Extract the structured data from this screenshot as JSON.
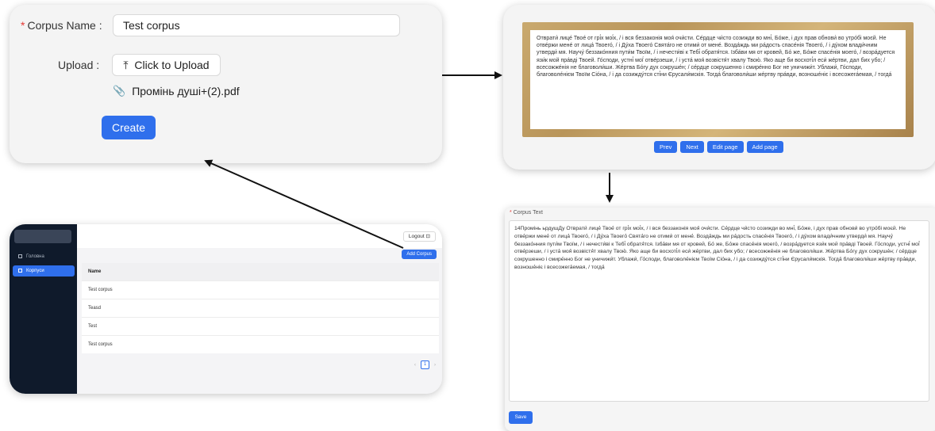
{
  "create_form": {
    "name_label": "Corpus Name",
    "name_value": "Test corpus",
    "upload_label": "Upload",
    "upload_button": "Click to Upload",
    "file_name": "Промінь душі+(2).pdf",
    "create_button": "Create"
  },
  "page_viewer": {
    "page_text": "Отврати́ лице́ Твое́ от грі́х моі́х, / і вся беззаконія моя́ очи́сти. Се́рдце чи́сто созижди во мні́, Бо́же, і дух прав обнови́ во утро́бі моєй. Не отве́ржи мене́ от лица́ Твоего́, / і Ду́ха Твоего́ Свята́го не отими́ от мене́. Возда́ждь ми ра́дость спасе́нія Твоего́, / і ду́хом влади́чним утверди́ мя. Научу́ беззако́нния пути́м Твоїм, / і нечести́ві к Тебі́ обратя́тся. Ізба́ви мя от кровей, Бо́ же, Бо́же спасе́нія моего́, / возра́дуется язи́к мой пра́вді Твоей. Го́споди, устні́ мої́ отве́рзеши, / і уста́ моя́ возвістя́т хвалу Твою́. Яко аще би восхоті́л еси́ же́ртви, дал бих убо; / всесожже́нія не благоволи́ши. Же́ртва Бо́гу дух сокруше́н; / се́рдце сокрушенно і смире́нно Бог не уничижи́т. Ублажи́, Го́споди, благоволе́нієм Твоїм Сіо́на, / і да созижду́тся сті́ни Єрусали́мскія. Тогда́ благоволи́ши же́ртву пра́вди, возноше́ніє і всесожега́емая, / тогда́",
    "buttons": [
      "Prev",
      "Next",
      "Edit page",
      "Add page"
    ]
  },
  "corpus_list": {
    "sidebar": [
      {
        "label": "Головна",
        "icon": "home-icon",
        "active": false
      },
      {
        "label": "Корпуси",
        "icon": "table-icon",
        "active": true
      }
    ],
    "logout_button": "Logout",
    "add_button": "Add Corpus",
    "column_header": "Name",
    "rows": [
      "Test corpus",
      "Teasd",
      "Test",
      "Test corpus"
    ],
    "current_page": "1"
  },
  "corpus_text": {
    "label": "Corpus Text",
    "text": "14Промінь ьрдушДу Отврати́ лице́ Твое́ от грі́х моі́х, / і вся беззаконія моя́ очи́сти. Се́рдце чи́сто созижди во мні́, Бо́же, і дух прав обнови́ во утро́бі моєй. Не отве́ржи мене́ от лица́ Твоего́, / і Ду́ха Твоего́ Свята́го не отими́ от мене́. Возда́ждь ми ра́дость спасе́нія Твоего́, / і ду́хом влади́чним утверди́ мя. Научу́ беззако́нния пути́м Твоїм, / і нечести́ві к Тебі́ обратя́тся. Ізба́ви мя от кровей, Бо́ же, Бо́же спасе́нія моего́, / возра́дуется язи́к мой пра́вді Твоей. Го́споди, устні́ мої́ отве́рзеши, / і уста́ моя́ возвістя́т хвалу Твою́. Яко аще би восхоті́л еси́ же́ртви, дал бих убо; / всесожже́нія не благоволи́ши. Же́ртва Бо́гу дух сокруше́н; / се́рдце сокрушенно і смире́нно Бог не уничижи́т. Ублажи́, Го́споди, благоволе́нієм Твоїм Сіо́на, / і да созижду́тся сті́ни Єрусали́мскія. Тогда́ благоволи́ши же́ртву пра́вди, возноше́ніє і всесожега́емая, / тогда́",
    "save_button": "Save"
  },
  "colors": {
    "primary": "#2f6fec",
    "sidebar": "#0f1a2b",
    "required": "#e53935"
  }
}
